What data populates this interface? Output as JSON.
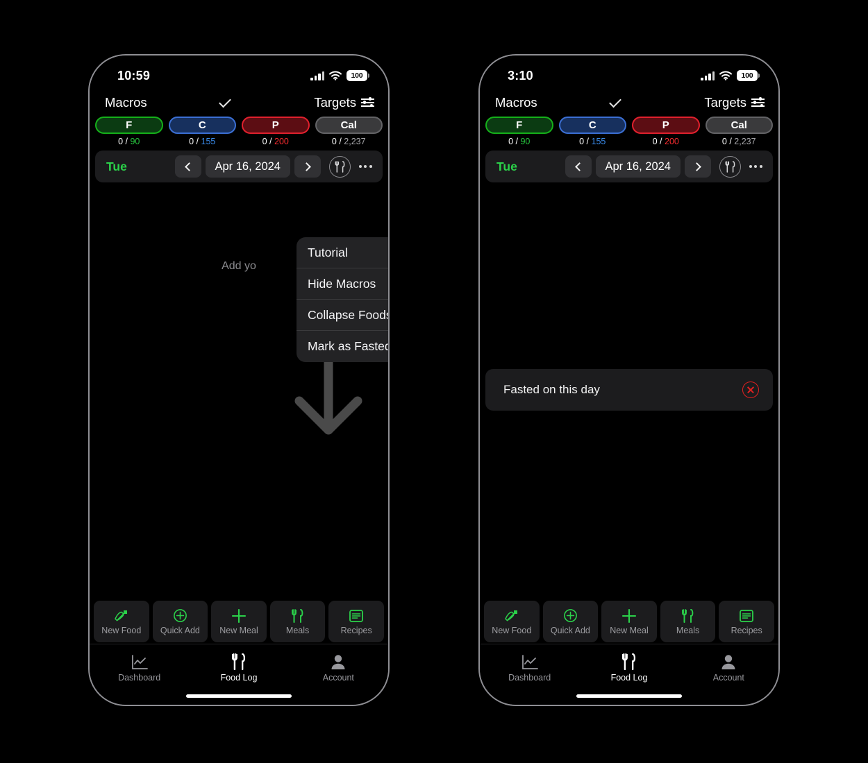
{
  "phones": [
    {
      "id": "left",
      "status": {
        "time": "10:59",
        "battery": "100",
        "signal_icon": "cellular-signal-icon",
        "wifi_icon": "wifi-icon",
        "battery_icon": "battery-icon"
      },
      "header": {
        "title": "Macros",
        "chevron_icon": "chevron-down-icon",
        "targets_label": "Targets",
        "targets_icon": "sliders-icon"
      },
      "macros": [
        {
          "key": "f",
          "label": "F",
          "consumed": "0",
          "sep": " / ",
          "target": "90",
          "fill": "#0b3b12",
          "border": "#15b01a",
          "value_color": "#27c93f"
        },
        {
          "key": "c",
          "label": "C",
          "consumed": "0",
          "sep": " / ",
          "target": "155",
          "fill": "#17305e",
          "border": "#3b6fd4",
          "value_color": "#3b8ef0"
        },
        {
          "key": "p",
          "label": "P",
          "consumed": "0",
          "sep": " / ",
          "target": "200",
          "fill": "#5c0d13",
          "border": "#e0202d",
          "value_color": "#ff2d30"
        },
        {
          "key": "cal",
          "label": "Cal",
          "consumed": "0",
          "sep": " / ",
          "target": "2,237",
          "fill": "#3a3a3c",
          "border": "#636366",
          "value_color": "#a9a9ad"
        }
      ],
      "datebar": {
        "weekday": "Tue",
        "date": "Apr 16, 2024",
        "prev_icon": "chevron-left-icon",
        "next_icon": "chevron-right-icon",
        "meal_icon": "fork-knife-circle-icon",
        "more_icon": "ellipsis-icon"
      },
      "empty_text": "Add yo",
      "fasted": null,
      "menu_open": true,
      "annotation_arrow": true
    },
    {
      "id": "right",
      "status": {
        "time": "3:10",
        "battery": "100",
        "signal_icon": "cellular-signal-icon",
        "wifi_icon": "wifi-icon",
        "battery_icon": "battery-icon"
      },
      "header": {
        "title": "Macros",
        "chevron_icon": "chevron-down-icon",
        "targets_label": "Targets",
        "targets_icon": "sliders-icon"
      },
      "macros": [
        {
          "key": "f",
          "label": "F",
          "consumed": "0",
          "sep": " / ",
          "target": "90",
          "fill": "#0b3b12",
          "border": "#15b01a",
          "value_color": "#27c93f"
        },
        {
          "key": "c",
          "label": "C",
          "consumed": "0",
          "sep": " / ",
          "target": "155",
          "fill": "#17305e",
          "border": "#3b6fd4",
          "value_color": "#3b8ef0"
        },
        {
          "key": "p",
          "label": "P",
          "consumed": "0",
          "sep": " / ",
          "target": "200",
          "fill": "#5c0d13",
          "border": "#e0202d",
          "value_color": "#ff2d30"
        },
        {
          "key": "cal",
          "label": "Cal",
          "consumed": "0",
          "sep": " / ",
          "target": "2,237",
          "fill": "#3a3a3c",
          "border": "#636366",
          "value_color": "#a9a9ad"
        }
      ],
      "datebar": {
        "weekday": "Tue",
        "date": "Apr 16, 2024",
        "prev_icon": "chevron-left-icon",
        "next_icon": "chevron-right-icon",
        "meal_icon": "fork-knife-circle-icon",
        "more_icon": "ellipsis-icon"
      },
      "empty_text": null,
      "fasted": {
        "label": "Fasted on this day",
        "remove_icon": "x-circle-icon",
        "remove_color": "#e02020"
      },
      "menu_open": false,
      "annotation_arrow": false
    }
  ],
  "context_menu": {
    "items": [
      {
        "label": "Tutorial",
        "icon": "info-circle-icon"
      },
      {
        "label": "Hide Macros",
        "icon": "hide-panel-icon"
      },
      {
        "label": "Collapse Foods",
        "icon": "collapse-vertical-icon"
      },
      {
        "label": "Mark as Fasted",
        "icon": "x-circle-filled-icon"
      }
    ]
  },
  "quick_actions": [
    {
      "label": "New Food",
      "icon": "carrot-icon"
    },
    {
      "label": "Quick Add",
      "icon": "plus-circle-icon"
    },
    {
      "label": "New Meal",
      "icon": "plus-icon"
    },
    {
      "label": "Meals",
      "icon": "fork-knife-icon"
    },
    {
      "label": "Recipes",
      "icon": "recipe-list-icon"
    }
  ],
  "tabs": [
    {
      "label": "Dashboard",
      "icon": "chart-line-icon",
      "active": false
    },
    {
      "label": "Food Log",
      "icon": "fork-knife-icon",
      "active": true
    },
    {
      "label": "Account",
      "icon": "person-icon",
      "active": false
    }
  ],
  "colors": {
    "accent_green": "#2bd14a",
    "background": "#000000",
    "card": "#1c1c1e",
    "menu": "#232325",
    "arrow_annotation": "#4a4a4a"
  }
}
